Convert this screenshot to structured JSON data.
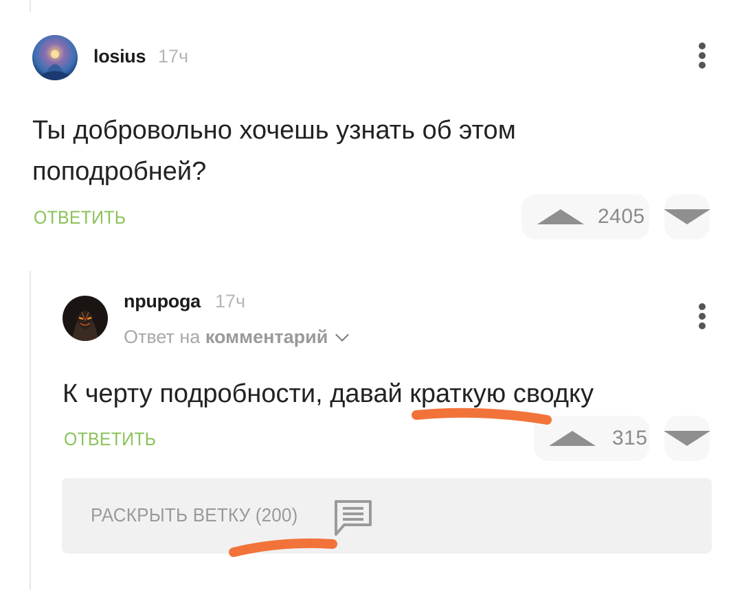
{
  "comments": [
    {
      "username": "losius",
      "time": "17ч",
      "text_lines": [
        "Ты добровольно хочешь узнать об этом",
        "поподробней?"
      ],
      "reply_label": "ОТВЕТИТЬ",
      "rating": "2405",
      "avatar_icon": "avatar-fantasy-art"
    },
    {
      "username": "npupoga",
      "time": "17ч",
      "reply_to_prefix": "Ответ на",
      "reply_to_target": "комментарий",
      "text": "К черту подробности, давай краткую сводку",
      "reply_label": "ОТВЕТИТЬ",
      "rating": "315",
      "avatar_icon": "avatar-dark-figure"
    }
  ],
  "expand_thread": {
    "label": "РАСКРЫТЬ ВЕТКУ (200)",
    "icon": "chat-bubble-icon"
  },
  "colors": {
    "reply_green": "#8ac25a",
    "annotation_orange": "#f2733a",
    "vote_gray": "#8f8f8f"
  }
}
